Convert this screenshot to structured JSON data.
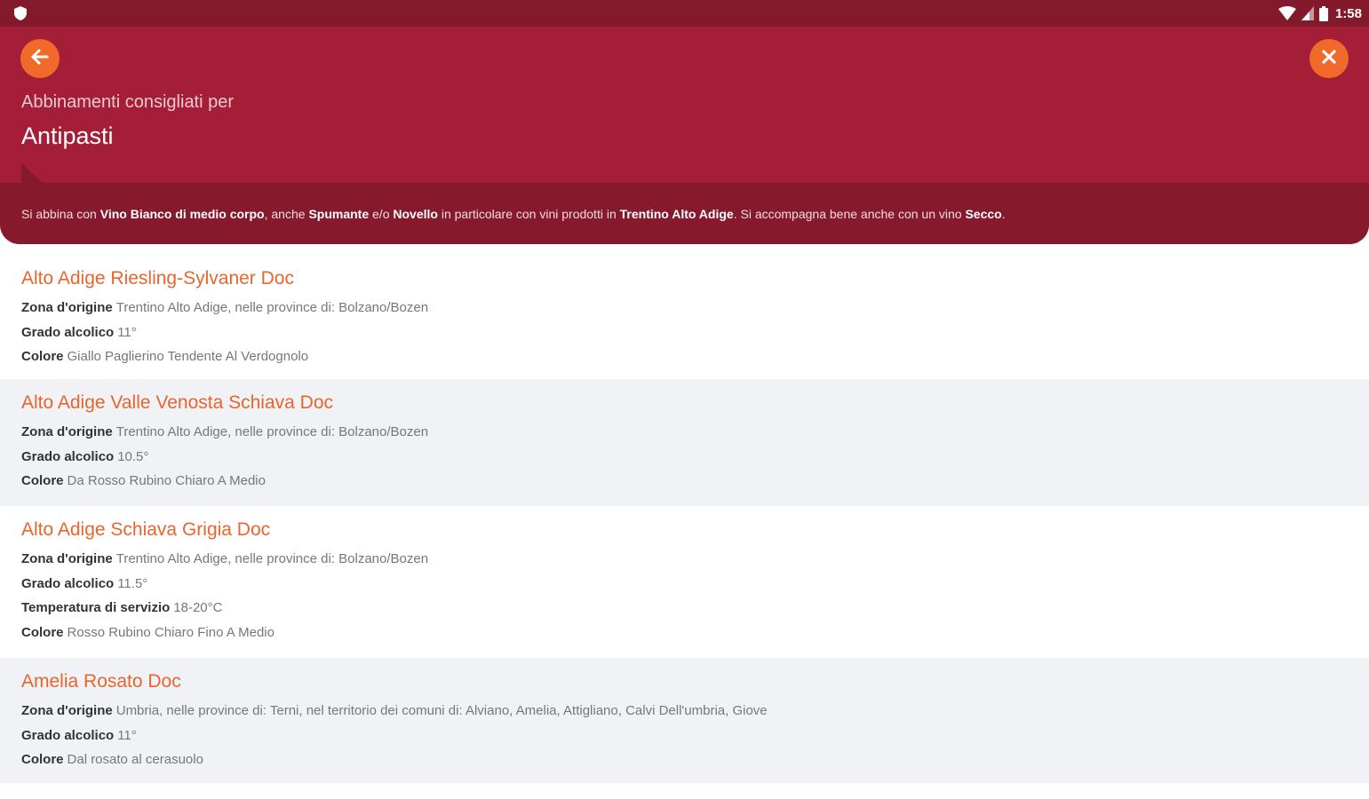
{
  "status_bar": {
    "time": "1:58",
    "left_icon": "shield-icon",
    "right_icons": [
      "wifi-icon",
      "signal-icon",
      "battery-icon"
    ]
  },
  "header": {
    "back_icon": "arrow-left-icon",
    "close_icon": "close-icon",
    "subtitle": "Abbinamenti consigliati per",
    "title": "Antipasti",
    "description": {
      "t1": "Si abbina con ",
      "b1": "Vino Bianco di medio corpo",
      "t2": ", anche ",
      "b2": "Spumante",
      "t3": " e/o ",
      "b3": "Novello",
      "t4": " in particolare con vini prodotti in ",
      "b4": "Trentino Alto Adige",
      "t5": ". Si accompagna bene anche con un vino ",
      "b5": "Secco",
      "t6": "."
    }
  },
  "colors": {
    "status_bar": "#831a2b",
    "header": "#a41e37",
    "description_band": "#86192b",
    "accent_orange": "#f26a2b",
    "wine_name": "#e8652d",
    "alt_row": "#f1f2f5"
  },
  "wines": [
    {
      "name": "Alto Adige Riesling-Sylvaner Doc",
      "details": [
        {
          "label": "Zona d'origine",
          "value": "Trentino Alto Adige, nelle province di: Bolzano/Bozen"
        },
        {
          "label": "Grado alcolico",
          "value": "11°"
        },
        {
          "label": "Colore",
          "value": "Giallo Paglierino Tendente Al Verdognolo"
        }
      ]
    },
    {
      "name": "Alto Adige Valle Venosta Schiava Doc",
      "details": [
        {
          "label": "Zona d'origine",
          "value": "Trentino Alto Adige, nelle province di: Bolzano/Bozen"
        },
        {
          "label": "Grado alcolico",
          "value": "10.5°"
        },
        {
          "label": "Colore",
          "value": "Da Rosso Rubino Chiaro A Medio"
        }
      ]
    },
    {
      "name": "Alto Adige Schiava Grigia Doc",
      "details": [
        {
          "label": "Zona d'origine",
          "value": "Trentino Alto Adige, nelle province di: Bolzano/Bozen"
        },
        {
          "label": "Grado alcolico",
          "value": "11.5°"
        },
        {
          "label": "Temperatura di servizio",
          "value": "18-20°C"
        },
        {
          "label": "Colore",
          "value": "Rosso Rubino Chiaro Fino A Medio"
        }
      ]
    },
    {
      "name": "Amelia Rosato Doc",
      "details": [
        {
          "label": "Zona d'origine",
          "value": "Umbria, nelle province di: Terni, nel territorio dei comuni di: Alviano, Amelia, Attigliano, Calvi Dell'umbria, Giove"
        },
        {
          "label": "Grado alcolico",
          "value": "11°"
        },
        {
          "label": "Colore",
          "value": "Dal rosato al cerasuolo"
        }
      ]
    }
  ]
}
